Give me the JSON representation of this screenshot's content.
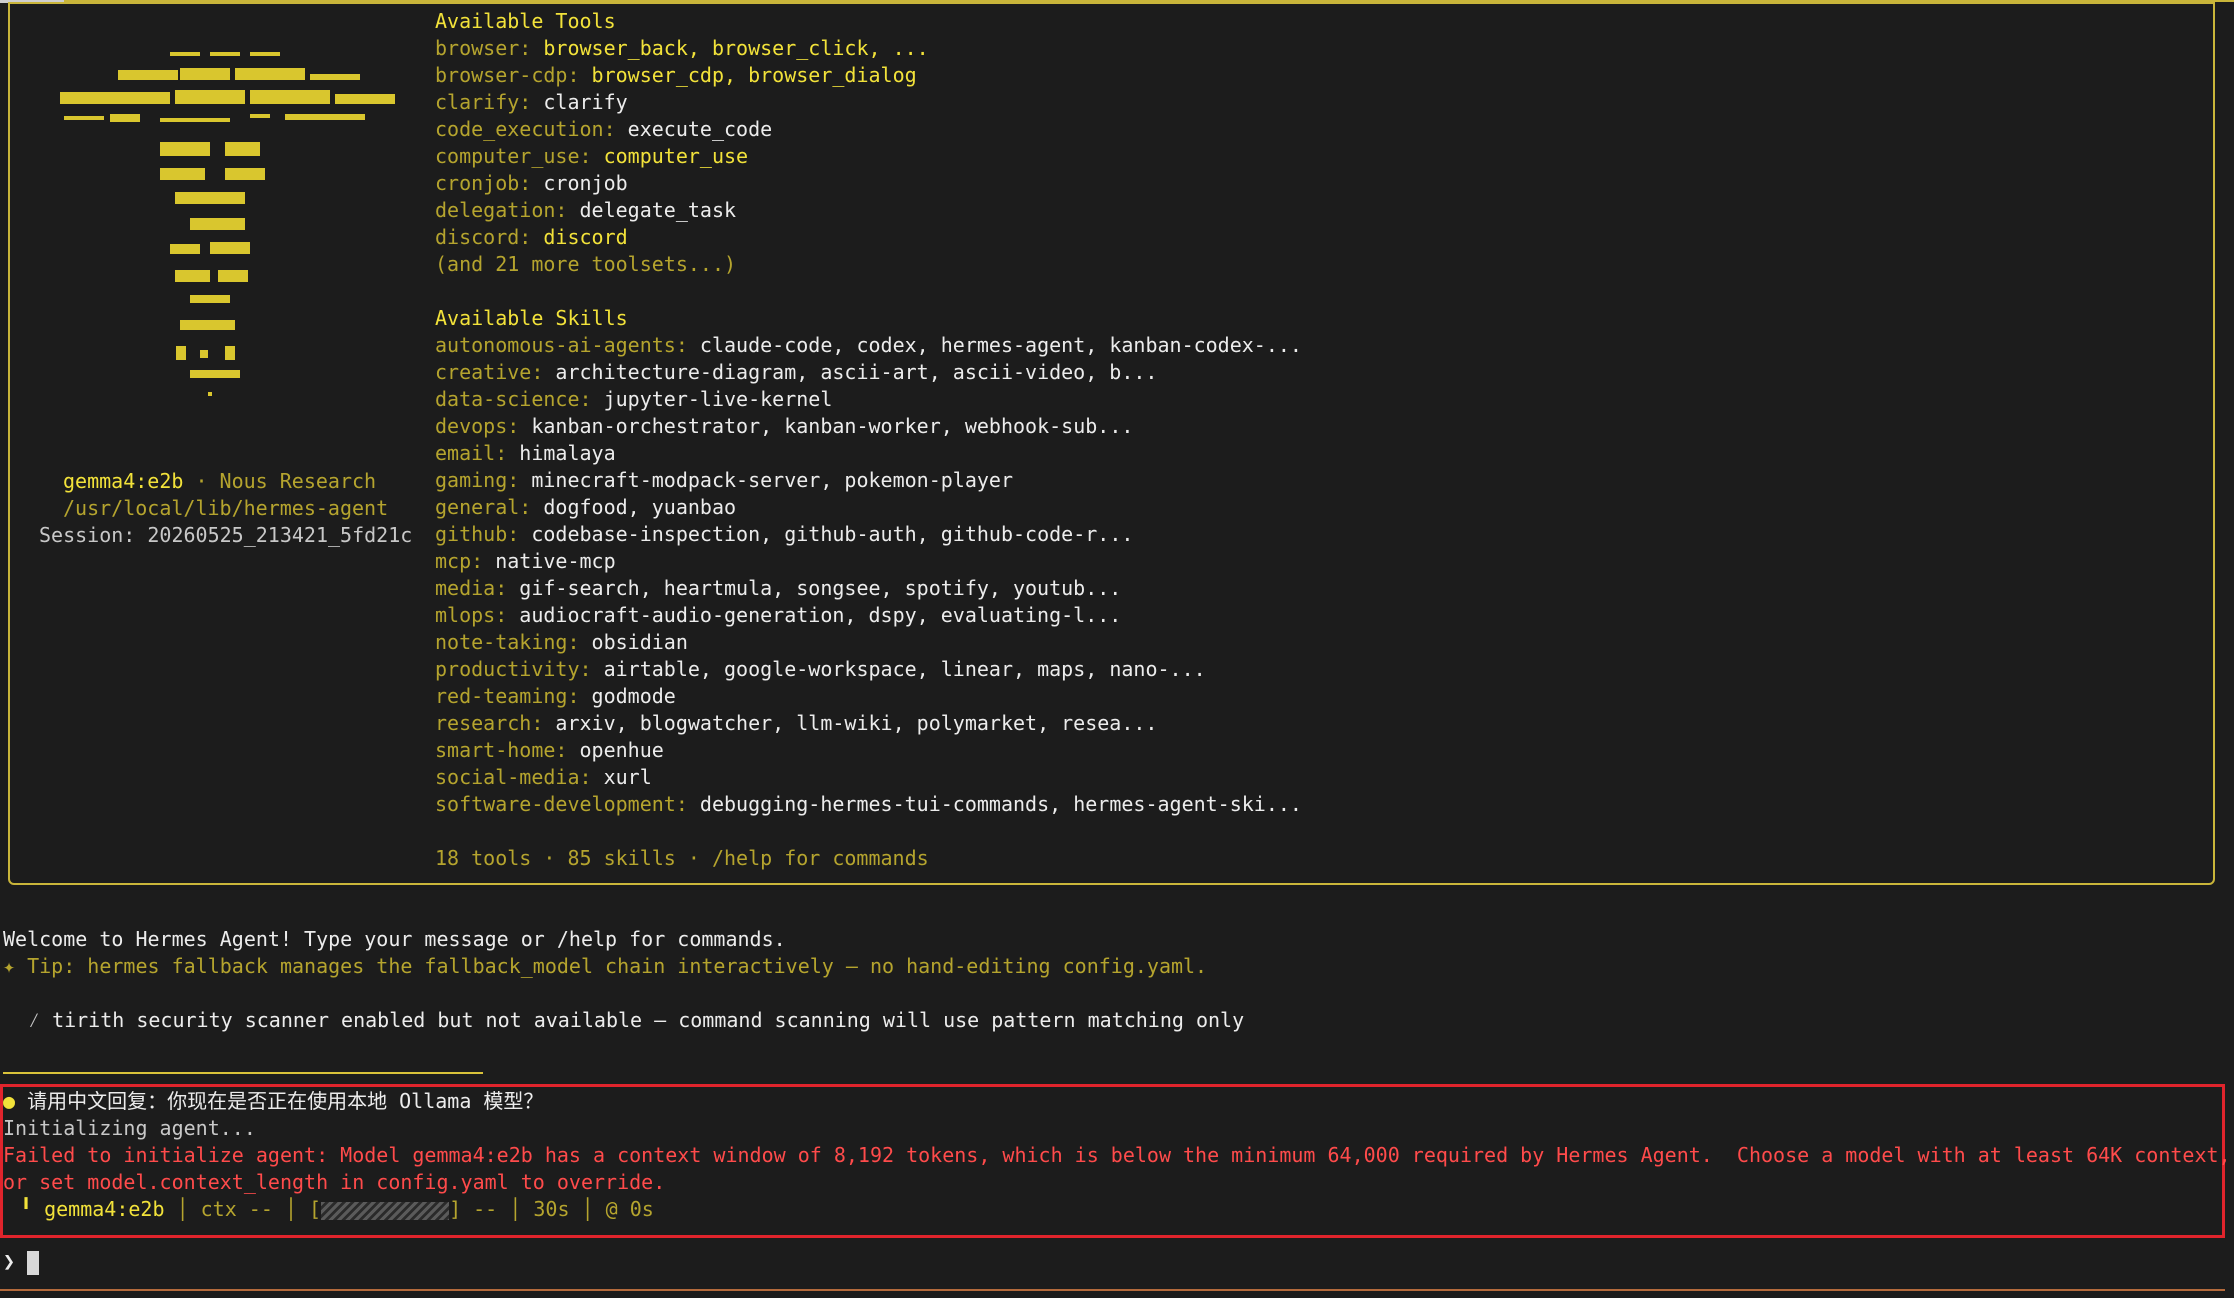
{
  "banner": {
    "model": "gemma4:e2b",
    "org": "Nous Research",
    "path": "/usr/local/lib/hermes-agent",
    "session": "Session: 20260525_213421_5fd21c"
  },
  "tools": {
    "heading": "Available Tools",
    "rows": [
      {
        "cat": "browser:",
        "items": "browser_back, browser_click, ..."
      },
      {
        "cat": "browser-cdp:",
        "items": "browser_cdp, browser_dialog"
      },
      {
        "cat": "clarify:",
        "items": "clarify"
      },
      {
        "cat": "code_execution:",
        "items": "execute_code"
      },
      {
        "cat": "computer_use:",
        "items": "computer_use"
      },
      {
        "cat": "cronjob:",
        "items": "cronjob"
      },
      {
        "cat": "delegation:",
        "items": "delegate_task"
      },
      {
        "cat": "discord:",
        "items": "discord"
      }
    ],
    "more": "(and 21 more toolsets...)"
  },
  "skills": {
    "heading": "Available Skills",
    "rows": [
      {
        "cat": "autonomous-ai-agents:",
        "items": "claude-code, codex, hermes-agent, kanban-codex-..."
      },
      {
        "cat": "creative:",
        "items": "architecture-diagram, ascii-art, ascii-video, b..."
      },
      {
        "cat": "data-science:",
        "items": "jupyter-live-kernel"
      },
      {
        "cat": "devops:",
        "items": "kanban-orchestrator, kanban-worker, webhook-sub..."
      },
      {
        "cat": "email:",
        "items": "himalaya"
      },
      {
        "cat": "gaming:",
        "items": "minecraft-modpack-server, pokemon-player"
      },
      {
        "cat": "general:",
        "items": "dogfood, yuanbao"
      },
      {
        "cat": "github:",
        "items": "codebase-inspection, github-auth, github-code-r..."
      },
      {
        "cat": "mcp:",
        "items": "native-mcp"
      },
      {
        "cat": "media:",
        "items": "gif-search, heartmula, songsee, spotify, youtub..."
      },
      {
        "cat": "mlops:",
        "items": "audiocraft-audio-generation, dspy, evaluating-l..."
      },
      {
        "cat": "note-taking:",
        "items": "obsidian"
      },
      {
        "cat": "productivity:",
        "items": "airtable, google-workspace, linear, maps, nano-..."
      },
      {
        "cat": "red-teaming:",
        "items": "godmode"
      },
      {
        "cat": "research:",
        "items": "arxiv, blogwatcher, llm-wiki, polymarket, resea..."
      },
      {
        "cat": "smart-home:",
        "items": "openhue"
      },
      {
        "cat": "social-media:",
        "items": "xurl"
      },
      {
        "cat": "software-development:",
        "items": "debugging-hermes-tui-commands, hermes-agent-ski..."
      }
    ],
    "summary": "18 tools · 85 skills · /help for commands"
  },
  "messages": {
    "welcome": "Welcome to Hermes Agent! Type your message or /help for commands.",
    "tip": "✦ Tip: hermes fallback manages the fallback_model chain interactively — no hand-editing config.yaml.",
    "warning": "tirith security scanner enabled but not available — command scanning will use pattern matching only",
    "warning_icon": "⁄"
  },
  "session_log": {
    "user_bullet": "●",
    "user_message": "请用中文回复：你现在是否正在使用本地 Ollama 模型？",
    "init": "Initializing agent...",
    "error_line1": "Failed to initialize agent: Model gemma4:e2b has a context window of 8,192 tokens, which is below the minimum 64,000 required by Hermes Agent.  Choose a model with at least 64K context,",
    "error_line2": "or set model.context_length in config.yaml to override."
  },
  "status_bar": {
    "model": "gemma4:e2b",
    "ctx": "ctx --",
    "bar_open": "[",
    "bar_close": "] --",
    "time": "30s",
    "clock_icon": "@",
    "elapsed": "0s"
  },
  "prompt": {
    "symbol": "❯"
  },
  "colors": {
    "accent_yellow": "#f2e23a",
    "label_olive": "#b5a42e",
    "error_red": "#ff4b4b",
    "border_red": "#e0242c"
  }
}
